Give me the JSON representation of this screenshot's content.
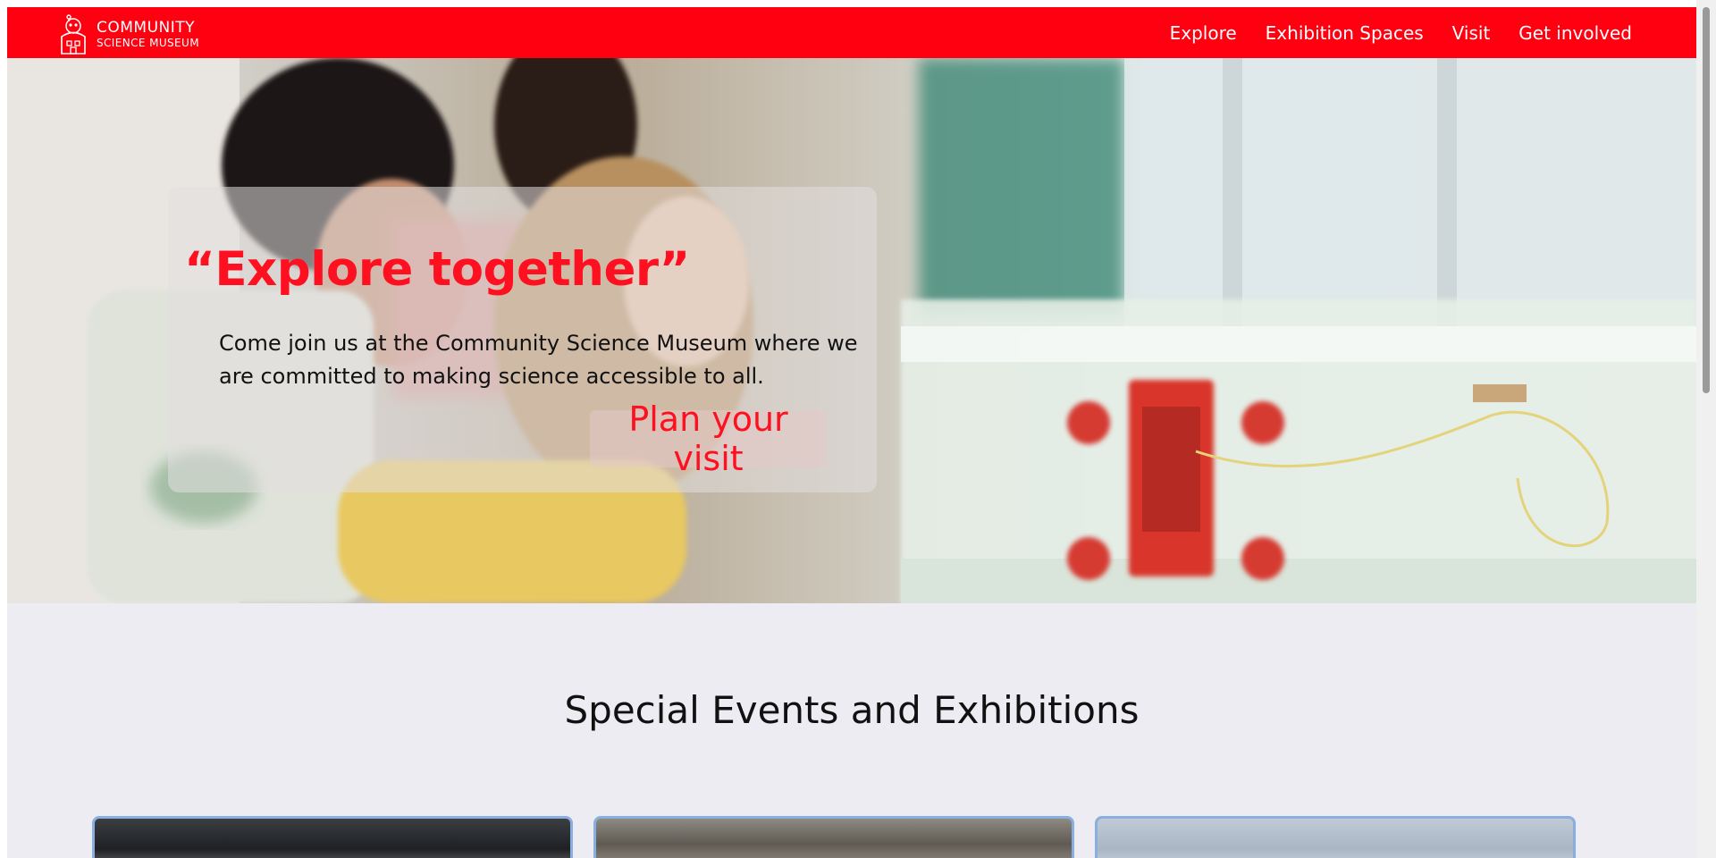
{
  "brand": {
    "line1": "COMMUNITY",
    "line2": "SCIENCE MUSEUM",
    "nav_color": "#ff0010"
  },
  "nav": {
    "items": [
      "Explore",
      "Exhibition Spaces",
      "Visit",
      "Get involved"
    ]
  },
  "hero": {
    "title": "“Explore together”",
    "text": "Come join us at the Community Science Museum where we are committed to making science accessible to all.",
    "button": "Plan your visit",
    "accent_color": "#ff1020"
  },
  "section": {
    "title": "Special Events and Exhibitions"
  }
}
